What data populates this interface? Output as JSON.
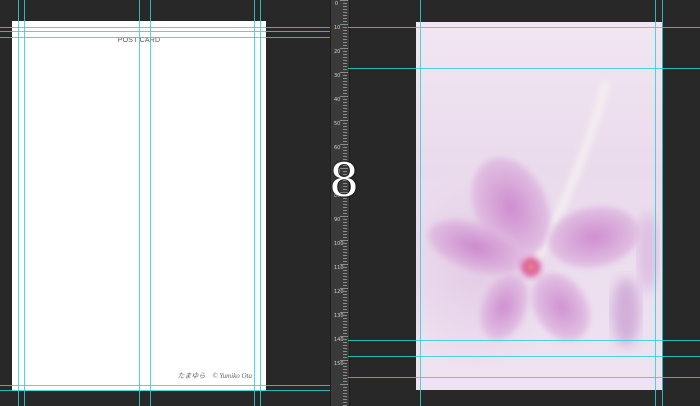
{
  "left_page": {
    "title": "POST CARD",
    "credit": "たまゆら　© Yumiko Ota"
  },
  "spread": {
    "page_number": "8"
  },
  "ruler": {
    "labels": [
      "0",
      "10",
      "20",
      "30",
      "40",
      "50",
      "60",
      "70",
      "80",
      "90",
      "100",
      "110",
      "120",
      "130",
      "140",
      "150"
    ]
  },
  "right_page": {
    "image": "pink-flower-photo"
  },
  "colors": {
    "background": "#282828",
    "guide": "#2ad4d4",
    "card": "#ffffff"
  }
}
